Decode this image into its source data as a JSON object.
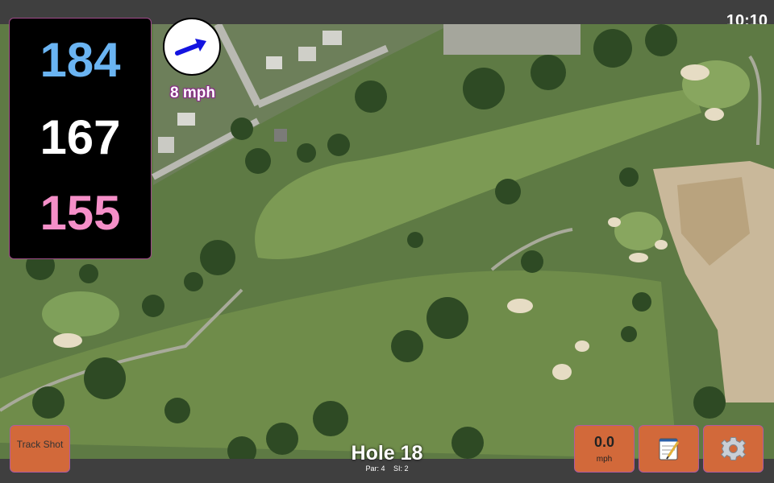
{
  "status_bar": {
    "time": "10:10"
  },
  "distances": {
    "back": "184",
    "middle": "167",
    "front": "155",
    "colors": {
      "back": "#6ab4f2",
      "middle": "#ffffff",
      "front": "#f58fc8"
    }
  },
  "wind": {
    "speed_label": "8 mph",
    "direction_icon": "arrow-right-icon"
  },
  "buttons": {
    "track_shot": "Track Shot",
    "wind_value": "0.0",
    "wind_unit": "mph",
    "notes_icon": "notepad-icon",
    "settings_icon": "gear-icon"
  },
  "hole": {
    "title": "Hole 18",
    "par": "Par: 4",
    "si": "SI: 2"
  },
  "colors": {
    "button": "#d2693a",
    "bar": "#3f3f3f",
    "accent_border": "#a04a8a"
  }
}
